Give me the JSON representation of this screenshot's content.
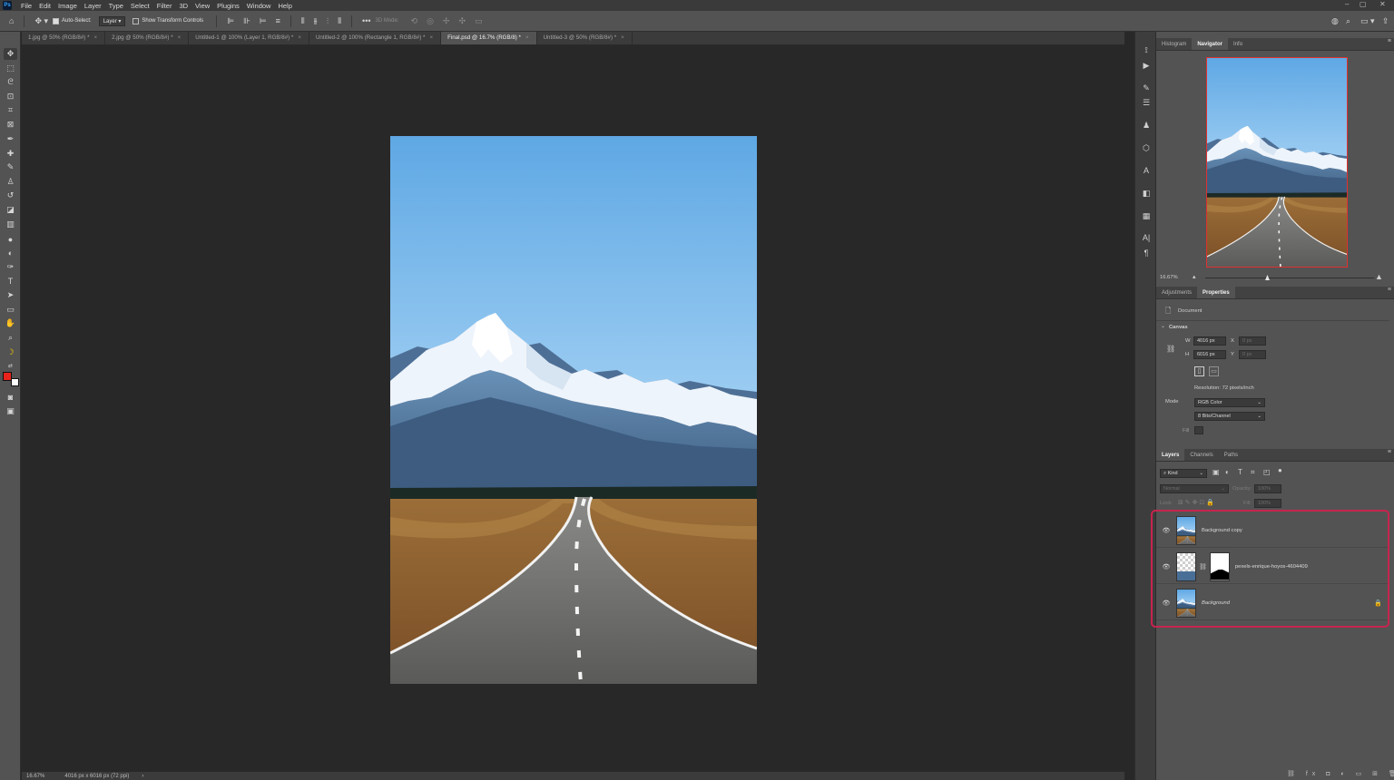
{
  "menu": {
    "logo": "Ps",
    "items": [
      "File",
      "Edit",
      "Image",
      "Layer",
      "Type",
      "Select",
      "Filter",
      "3D",
      "View",
      "Plugins",
      "Window",
      "Help"
    ],
    "window_controls": [
      "–",
      "▢",
      "✕"
    ]
  },
  "options": {
    "auto_select_label": "Auto-Select:",
    "auto_select_value": "Layer",
    "transform_label": "Show Transform Controls",
    "mode_3d_label": "3D Mode:"
  },
  "tabs": [
    {
      "label": "1.jpg @ 50% (RGB/8#) *",
      "active": false
    },
    {
      "label": "2.jpg @ 50% (RGB/8#) *",
      "active": false
    },
    {
      "label": "Untitled-1 @ 100% (Layer 1, RGB/8#) *",
      "active": false
    },
    {
      "label": "Untitled-2 @ 100% (Rectangle 1, RGB/8#) *",
      "active": false
    },
    {
      "label": "Final.psd @ 16.7% (RGB/8) *",
      "active": true
    },
    {
      "label": "Untitled-3 @ 50% (RGB/8#) *",
      "active": false
    }
  ],
  "status": {
    "zoom": "16.67%",
    "doc_size": "4016 px x 6016 px (72 ppi)",
    "arrow": "›"
  },
  "navigator": {
    "tabs": [
      "Histogram",
      "Navigator",
      "Info"
    ],
    "active_tab": "Navigator",
    "zoom": "16.67%"
  },
  "properties": {
    "tabs": [
      "Adjustments",
      "Properties"
    ],
    "active_tab": "Properties",
    "document_label": "Document",
    "canvas_label": "Canvas",
    "width_label": "W",
    "width_value": "4016 px",
    "height_label": "H",
    "height_value": "6016 px",
    "x_label": "X",
    "x_value": "0 px",
    "y_label": "Y",
    "y_value": "0 px",
    "resolution": "Resolution: 72 pixels/inch",
    "mode_label": "Mode",
    "mode_value": "RGB Color",
    "depth_value": "8 Bits/Channel",
    "fill_label": "Fill"
  },
  "layers": {
    "tabs": [
      "Layers",
      "Channels",
      "Paths"
    ],
    "active_tab": "Layers",
    "filter_kind": "Kind",
    "blend_mode": "Normal",
    "opacity_label": "Opacity:",
    "opacity_value": "100%",
    "lock_label": "Lock:",
    "fill_label": "Fill:",
    "fill_value": "100%",
    "items": [
      {
        "name": "Background copy",
        "italic": false
      },
      {
        "name": "pexels-enrique-hoyos-4604409",
        "italic": false
      },
      {
        "name": "Background",
        "italic": true
      }
    ]
  },
  "colors": {
    "foreground": "#e8231b",
    "background": "#ffffff",
    "highlight": "#c7244e",
    "navigator_frame": "#e03030"
  },
  "icons": [
    "home-icon",
    "move-icon",
    "marquee-icon",
    "lasso-icon",
    "quick-select-icon",
    "crop-icon",
    "frame-icon",
    "eyedropper-icon",
    "healing-icon",
    "brush-icon",
    "stamp-icon",
    "history-brush-icon",
    "eraser-icon",
    "gradient-icon",
    "blur-icon",
    "dodge-icon",
    "pen-icon",
    "type-icon",
    "path-select-icon",
    "rectangle-icon",
    "hand-icon",
    "zoom-icon",
    "eye-icon",
    "lock-icon"
  ]
}
